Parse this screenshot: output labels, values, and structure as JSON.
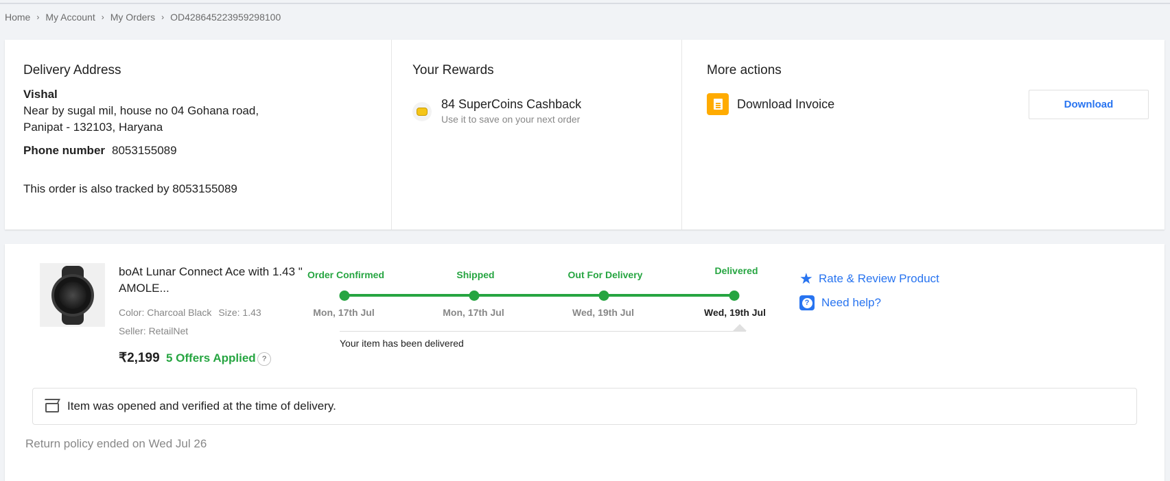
{
  "breadcrumb": [
    "Home",
    "My Account",
    "My Orders",
    "OD428645223959298100"
  ],
  "address": {
    "heading": "Delivery Address",
    "name": "Vishal",
    "line1": "Near by sugal mil, house no 04 Gohana road,",
    "line2": "Panipat - 132103, Haryana",
    "phone_label": "Phone number",
    "phone": "8053155089",
    "tracked": "This order is also tracked by 8053155089"
  },
  "rewards": {
    "heading": "Your Rewards",
    "title": "84 SuperCoins Cashback",
    "subtitle": "Use it to save on your next order"
  },
  "actions": {
    "heading": "More actions",
    "invoice_label": "Download Invoice",
    "download_button": "Download"
  },
  "product": {
    "title": "boAt Lunar Connect Ace with 1.43 \" AMOLE...",
    "color": "Color: Charcoal Black",
    "size": "Size: 1.43",
    "seller": "Seller: RetailNet",
    "price": "₹2,199",
    "offers": "5 Offers Applied",
    "help_glyph": "?"
  },
  "tracking": {
    "steps": [
      {
        "label": "Order Confirmed",
        "date": "Mon, 17th Jul"
      },
      {
        "label": "Shipped",
        "date": "Mon, 17th Jul"
      },
      {
        "label": "Out For Delivery",
        "date": "Wed, 19th Jul"
      },
      {
        "label": "Delivered",
        "date": "Wed, 19th Jul"
      }
    ],
    "message": "Your item has been delivered"
  },
  "side_actions": {
    "rate": "Rate & Review Product",
    "help": "Need help?"
  },
  "verify_text": "Item was opened and verified at the time of delivery.",
  "return_text": "Return policy ended on Wed Jul 26",
  "colors": {
    "brand_blue": "#2874f0",
    "success_green": "#26a541",
    "invoice_orange": "#ffab00"
  }
}
